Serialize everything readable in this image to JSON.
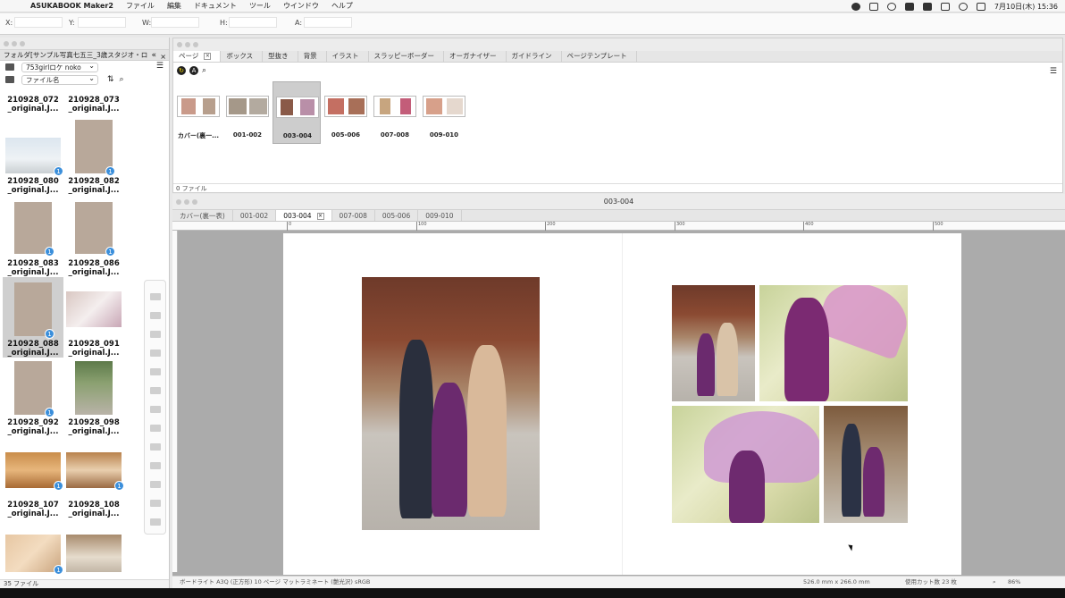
{
  "menubar": {
    "apple": "",
    "app_name": "ASUKABOOK Maker2",
    "items": [
      "ファイル",
      "編集",
      "ドキュメント",
      "ツール",
      "ウインドウ",
      "ヘルプ"
    ],
    "datetime": "7月10日(木) 15:36"
  },
  "coordbar": {
    "x_label": "X:",
    "y_label": "Y:",
    "w_label": "W:",
    "h_label": "H:",
    "a_label": "A:"
  },
  "left_panel": {
    "tab_title": "フォルダ[サンプル写真七五三_3歳スタジオ・ロ",
    "collapse": "«",
    "close": "×",
    "folder_select": "753girlロケ noko",
    "sort_select": "ファイル名",
    "thumbnails": [
      {
        "line1": "210928_072",
        "line2": "_original.J...",
        "badge": ""
      },
      {
        "line1": "210928_073",
        "line2": "_original.J...",
        "badge": ""
      },
      {
        "line1": "210928_080",
        "line2": "_original.J...",
        "badge": "1"
      },
      {
        "line1": "210928_082",
        "line2": "_original.J...",
        "badge": "1"
      },
      {
        "line1": "210928_083",
        "line2": "_original.J...",
        "badge": "1"
      },
      {
        "line1": "210928_086",
        "line2": "_original.J...",
        "badge": "1"
      },
      {
        "line1": "210928_088",
        "line2": "_original.J...",
        "badge": "1"
      },
      {
        "line1": "210928_091",
        "line2": "_original.J...",
        "badge": ""
      },
      {
        "line1": "210928_092",
        "line2": "_original.J...",
        "badge": "1"
      },
      {
        "line1": "210928_098",
        "line2": "_original.J...",
        "badge": ""
      },
      {
        "line1": "210928_107",
        "line2": "_original.J...",
        "badge": "1"
      },
      {
        "line1": "210928_108",
        "line2": "_original.J...",
        "badge": "1"
      },
      {
        "line1": "",
        "line2": "",
        "badge": "1"
      },
      {
        "line1": "",
        "line2": "",
        "badge": ""
      }
    ],
    "footer": "35 ファイル"
  },
  "page_panel": {
    "tabs": [
      "ページ",
      "ボックス",
      "型抜き",
      "背景",
      "イラスト",
      "スラッピーボーダー",
      "オーガナイザー",
      "ガイドライン",
      "ページテンプレート"
    ],
    "spreads": [
      "カバー(裏一...",
      "001-002",
      "003-004",
      "005-006",
      "007-008",
      "009-010"
    ],
    "footer": "0 ファイル"
  },
  "document": {
    "title": "003-004",
    "tabs": [
      "カバー(裏一表)",
      "001-002",
      "003-004",
      "007-008",
      "005-006",
      "009-010"
    ],
    "ruler_ticks": [
      "0",
      "100",
      "200",
      "300",
      "400",
      "500"
    ],
    "status_left": "ボードライト A3Q (正方形) 10 ページ マットラミネート (艶光沢) sRGB",
    "status_size": "526.0 mm x 266.0 mm",
    "status_cuts": "使用カット数 23 枚",
    "status_zoom": "86%"
  }
}
